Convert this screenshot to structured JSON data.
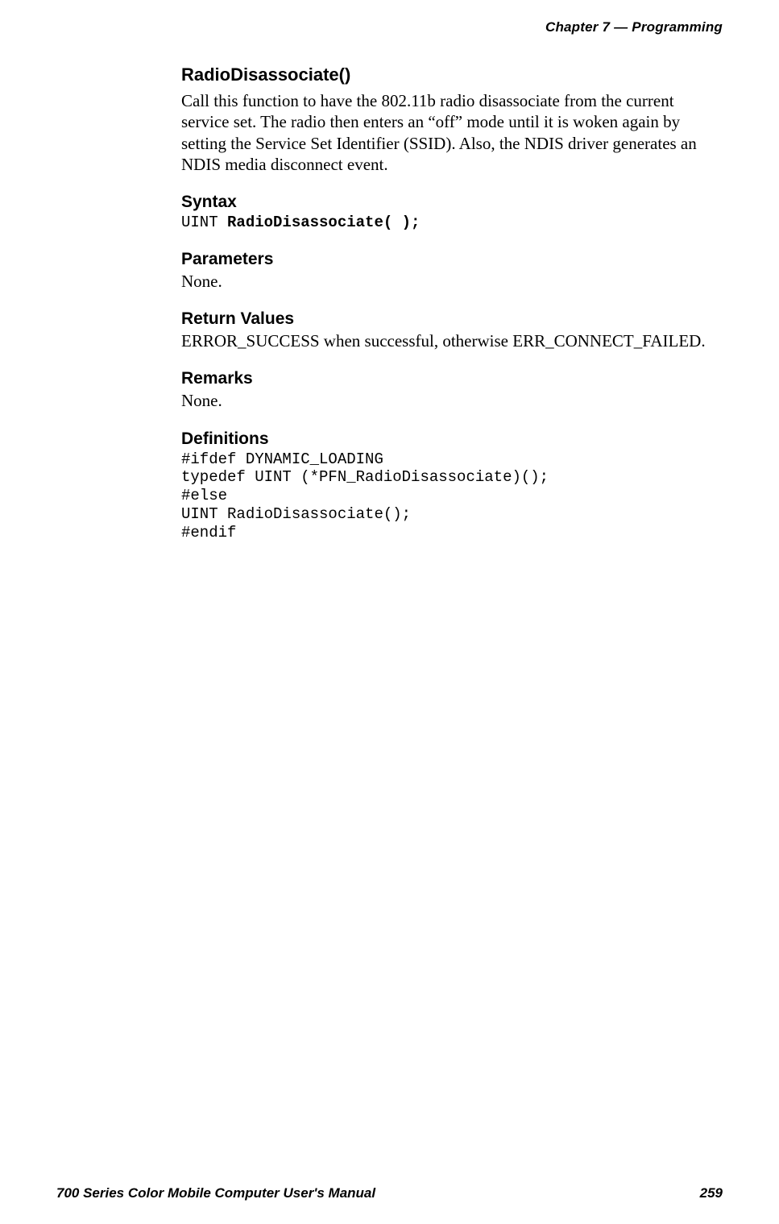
{
  "header": {
    "chapter_label": "Chapter",
    "chapter_number": "7",
    "separator": "—",
    "chapter_title": "Programming"
  },
  "content": {
    "title": "RadioDisassociate()",
    "intro": "Call this function to have the 802.11b radio disassociate from the current service set. The radio then enters an “off” mode until it is woken again by setting the Service Set Identifier (SSID). Also, the NDIS driver generates an NDIS media disconnect event.",
    "syntax": {
      "heading": "Syntax",
      "code_prefix": "UINT ",
      "code_bold": "RadioDisassociate( );"
    },
    "parameters": {
      "heading": "Parameters",
      "text": "None."
    },
    "return_values": {
      "heading": "Return Values",
      "text": "ERROR_SUCCESS when successful, otherwise ERR_CONNECT_FAILED."
    },
    "remarks": {
      "heading": "Remarks",
      "text": "None."
    },
    "definitions": {
      "heading": "Definitions",
      "lines": [
        "#ifdef DYNAMIC_LOADING",
        "typedef UINT (*PFN_RadioDisassociate)();",
        "#else",
        "UINT RadioDisassociate();",
        "#endif"
      ]
    }
  },
  "footer": {
    "manual_title": "700 Series Color Mobile Computer User's Manual",
    "page_number": "259"
  }
}
